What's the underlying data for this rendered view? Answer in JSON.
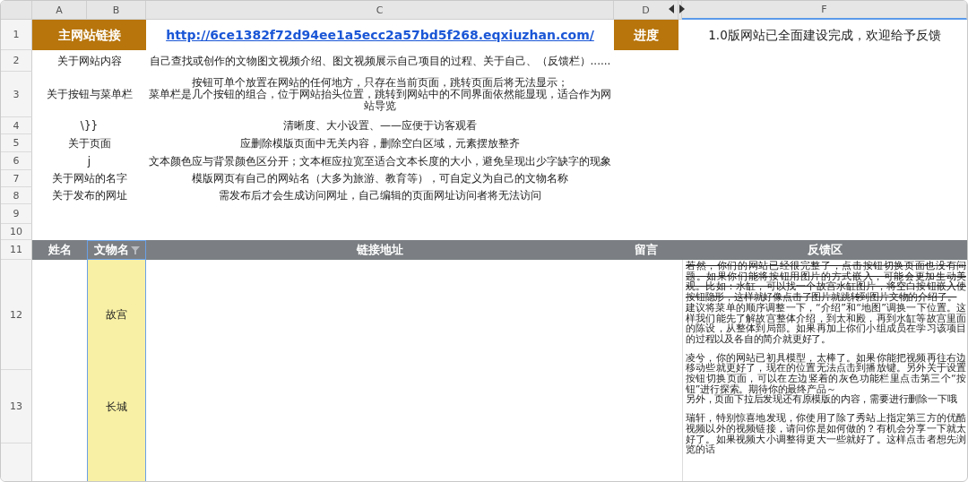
{
  "columns": [
    {
      "label": "A",
      "selected": false
    },
    {
      "label": "B",
      "selected": false
    },
    {
      "label": "C",
      "selected": false
    },
    {
      "label": "D",
      "selected": false
    },
    {
      "label": "F",
      "selected": true
    }
  ],
  "row_numbers": [
    "1",
    "2",
    "3",
    "4",
    "5",
    "6",
    "7",
    "8",
    "9",
    "10",
    "11",
    "12",
    "13"
  ],
  "header": {
    "title": "主网站链接",
    "link": "http://6ce1382f72d94ee1a5ecc2a57bd5f268.eqxiuzhan.com/",
    "progress_label": "进度",
    "progress": "1.0版网站已全面建设完成，欢迎给予反馈"
  },
  "notes": [
    {
      "topic": "关于网站内容",
      "detail": "自己查找或创作的文物图文视频介绍、图文视频展示自己项目的过程、关于自己、（反馈栏）......"
    },
    {
      "topic": "关于按钮与菜单栏",
      "detail": "按钮可单个放置在网站的任何地方，只存在当前页面，跳转页面后将无法显示；",
      "detail_2": "菜单栏是几个按钮的组合，位于网站抬头位置，跳转到网站中的不同界面依然能显现，适合作为网站导览"
    },
    {
      "topic": "\\}}",
      "detail": "清晰度、大小设置、——应便于访客观看"
    },
    {
      "topic": "关于页面",
      "detail": "应删除模版页面中无关内容，删除空白区域，元素摆放整齐"
    },
    {
      "topic": "j",
      "detail": "文本颜色应与背景颜色区分开；文本框应拉宽至适合文本长度的大小，避免呈现出少字缺字的现象"
    },
    {
      "topic": "关于网站的名字",
      "detail": "模版网页有自己的网站名（大多为旅游、教育等），可自定义为自己的文物名称"
    },
    {
      "topic": "关于发布的网址",
      "detail": "需发布后才会生成访问网址，自己编辑的页面网址访问者将无法访问"
    }
  ],
  "table": {
    "columns": [
      {
        "label": "姓名",
        "filter": false
      },
      {
        "label": "文物名",
        "filter": true
      },
      {
        "label": "链接地址",
        "filter": false
      },
      {
        "label": "留言",
        "filter": false
      },
      {
        "label": "反馈区",
        "filter": false
      }
    ],
    "rows": [
      {
        "relic": "故宫"
      },
      {
        "relic": "长城"
      }
    ],
    "feedback": [
      {
        "paragraphs": [
          {
            "text": "若然，你们的网站已经很完整了，点击按钮切换页面也没有问题。如果你们能将按钮用图片的方式嵌入，可能会更加生动美观。比如：水缸，可以找一个故宫水缸图片，将空白按钮嵌入使按钮隐形，这样就好像点击了图片就跳转到图片文物的介绍了。",
            "strikethrough": true
          },
          {
            "text": "建议将菜单的顺序调整一下，“介绍”和“地图”调换一下位置。这样我们能先了解故宫整体介绍，到太和殿，再到水缸等故宫里面的陈设，从整体到局部。如果再加上你们小组成员在学习该项目的过程以及各自的简介就更好了。",
            "strikethrough": false
          }
        ]
      },
      {
        "paragraphs": [
          {
            "text": "凌兮，你的网站已初具模型，太棒了。如果你能把视频再往右边移动些就更好了，现在的位置无法点击到播放键。另外关于设置按钮切换页面，可以在左边竖着的灰色功能栏里点击第三个“按钮”进行探索。期待你的最终产品～",
            "strikethrough": false
          },
          {
            "text": "另外，页面下拉后发现还有原模版的内容，需要进行删除一下哦",
            "strikethrough": false
          }
        ]
      },
      {
        "paragraphs": [
          {
            "text": "瑞轩，特别惊喜地发现，你使用了除了秀站上指定第三方的优酷视频以外的视频链接，请问你是如何做的？有机会分享一下就太好了。如果视频大小调整得更大一些就好了。这样点击者想先浏览的话",
            "strikethrough": false
          }
        ]
      }
    ]
  }
}
